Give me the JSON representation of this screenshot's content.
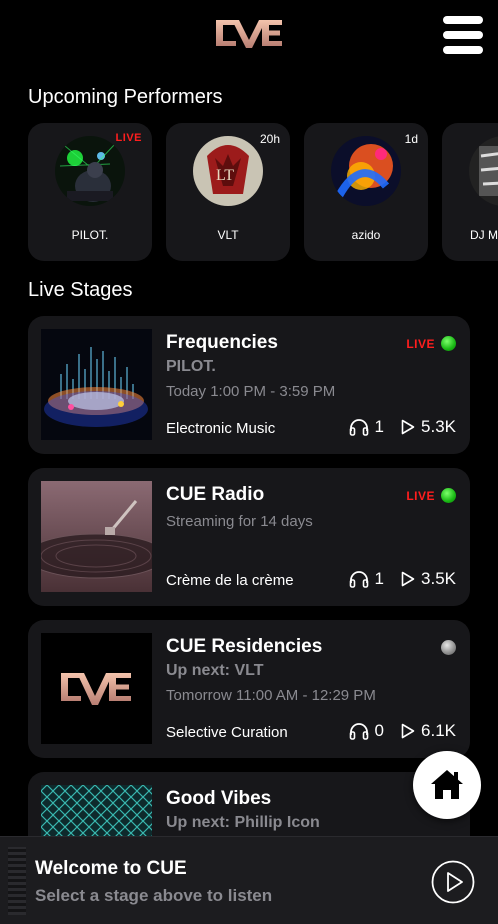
{
  "app": {
    "logo_text": "CUE",
    "menu_icon": "hamburger-menu-icon"
  },
  "upcoming": {
    "title": "Upcoming Performers",
    "performers": [
      {
        "name": "PILOT.",
        "badge": "LIVE",
        "is_live": true
      },
      {
        "name": "VLT",
        "badge": "20h",
        "is_live": false
      },
      {
        "name": "azido",
        "badge": "1d",
        "is_live": false
      },
      {
        "name": "DJ M",
        "badge": "",
        "is_live": false
      }
    ]
  },
  "live_stages": {
    "title": "Live Stages",
    "stages": [
      {
        "title": "Frequencies",
        "subtitle": "PILOT.",
        "time": "Today 1:00 PM - 3:59 PM",
        "genre": "Electronic Music",
        "listeners": "1",
        "plays": "5.3K",
        "live_label": "LIVE",
        "status": "live"
      },
      {
        "title": "CUE Radio",
        "subtitle": "",
        "time": "Streaming for 14 days",
        "genre": "Crème de la crème",
        "listeners": "1",
        "plays": "3.5K",
        "live_label": "LIVE",
        "status": "live"
      },
      {
        "title": "CUE Residencies",
        "subtitle": "Up next: VLT",
        "time": "Tomorrow 11:00 AM - 12:29 PM",
        "genre": "Selective Curation",
        "listeners": "0",
        "plays": "6.1K",
        "live_label": "",
        "status": "offline"
      },
      {
        "title": "Good Vibes",
        "subtitle": "Up next: Phillip Icon",
        "time": "",
        "genre": "",
        "listeners": "",
        "plays": "",
        "live_label": "",
        "status": ""
      }
    ]
  },
  "player": {
    "title": "Welcome to CUE",
    "subtitle": "Select a stage above to listen"
  },
  "colors": {
    "background": "#000000",
    "card": "#17171a",
    "live_red": "#ff1e1e",
    "live_green": "#19b814",
    "muted_text": "#8a8a90"
  }
}
